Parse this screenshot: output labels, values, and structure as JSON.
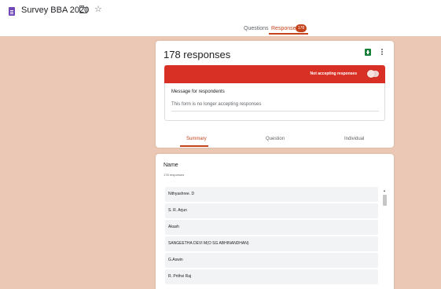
{
  "app": {
    "title": "Survey BBA 2020"
  },
  "tabs": [
    {
      "label": "Questions"
    },
    {
      "label": "Responses",
      "badge": "178"
    }
  ],
  "header_card": {
    "title": "178 responses",
    "status_text": "Not accepting responses",
    "message_label": "Message for respondents",
    "message_text": "This form is no longer accepting responses"
  },
  "subtabs": [
    {
      "label": "Summary"
    },
    {
      "label": "Question"
    },
    {
      "label": "Individual"
    }
  ],
  "name_section": {
    "label": "Name",
    "count": "178 responses",
    "responses": [
      "Nithyashree. D",
      "S. R. Arjun",
      "Akash",
      "SANGEETHA DEVI M(O SG ABHINANDHAN)",
      "G.Aswin",
      "R. Prithvi Raj"
    ]
  },
  "colors": {
    "accent": "#c5421b",
    "banner": "#d93025",
    "background": "#ebc8b5",
    "sheets": "#188038"
  },
  "icons": [
    "form-icon",
    "folder-icon",
    "star-icon",
    "sheets-icon",
    "more-vert-icon",
    "toggle-switch"
  ]
}
